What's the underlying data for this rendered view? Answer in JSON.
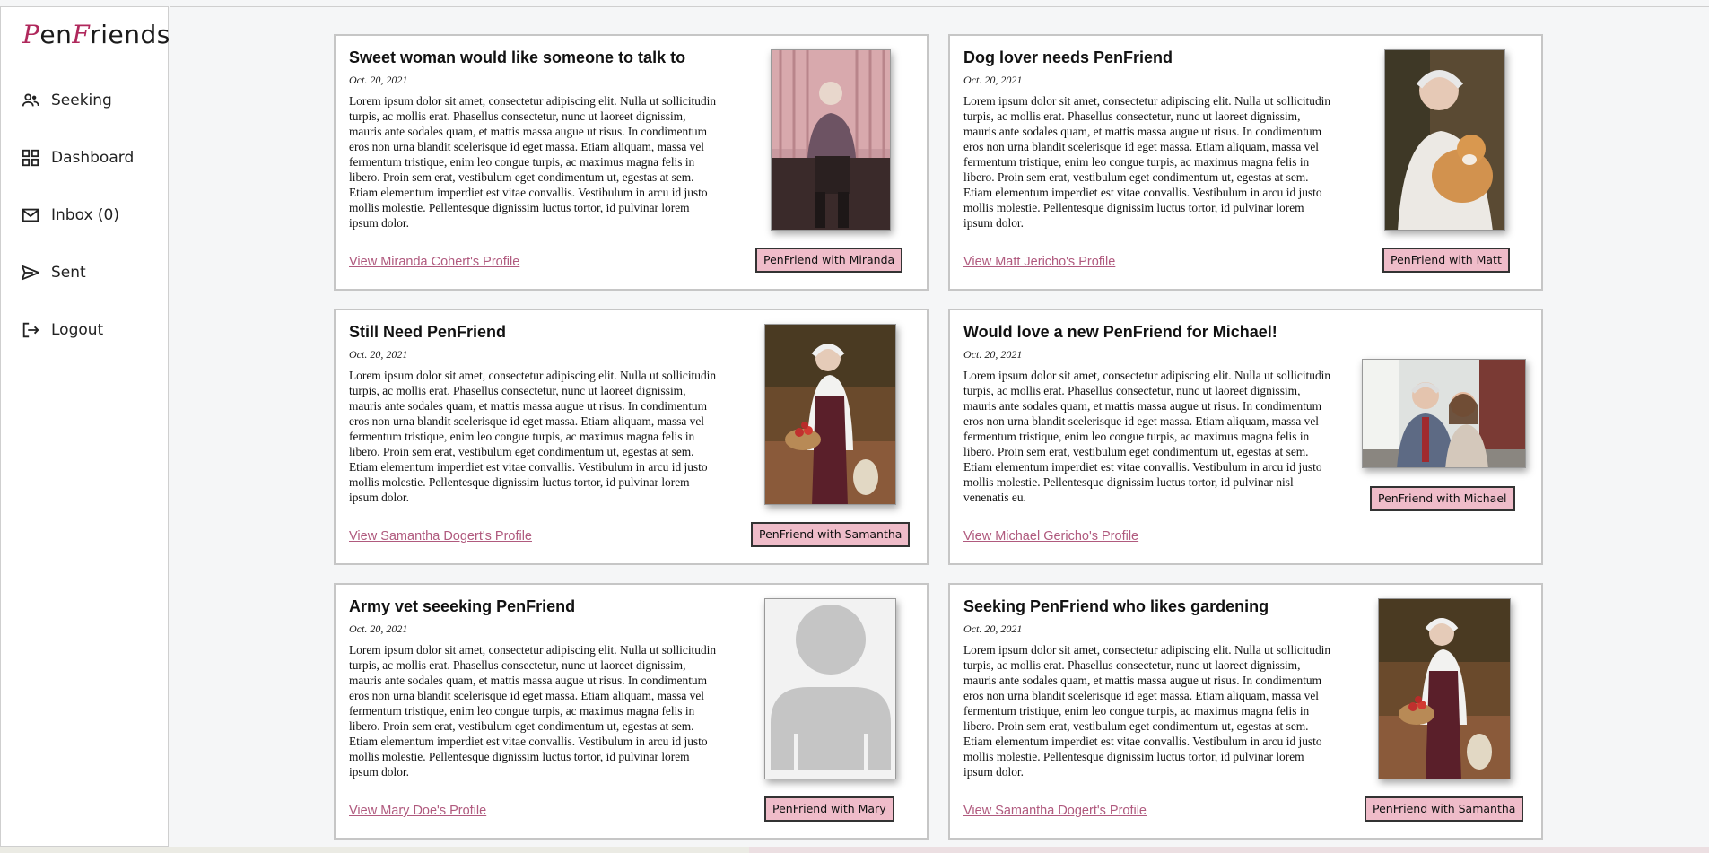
{
  "app": {
    "logo": {
      "part1": "P",
      "part2": "en",
      "part3": "F",
      "part4": "riends"
    },
    "accent_color": "#b0285c",
    "link_color": "#b05a7e",
    "button_color": "#efbcc9"
  },
  "sidebar": {
    "items": [
      {
        "label": "Seeking",
        "icon": "people-icon"
      },
      {
        "label": "Dashboard",
        "icon": "grid-icon"
      },
      {
        "label": "Inbox (0)",
        "icon": "mail-icon"
      },
      {
        "label": "Sent",
        "icon": "send-icon"
      },
      {
        "label": "Logout",
        "icon": "logout-icon"
      }
    ]
  },
  "lorem": "Lorem ipsum dolor sit amet, consectetur adipiscing elit. Nulla ut sollicitudin turpis, ac mollis erat. Phasellus consectetur, nunc ut laoreet dignissim, mauris ante sodales quam, et mattis massa augue ut risus. In condimentum eros non urna blandit scelerisque id eget massa. Etiam aliquam, massa vel fermentum tristique, enim leo congue turpis, ac maximus magna felis in libero. Proin sem erat, vestibulum eget condimentum ut, egestas at sem. Etiam elementum imperdiet est vitae convallis. Vestibulum in arcu id justo mollis molestie. Pellentesque dignissim luctus tortor, id pulvinar lorem ipsum dolor.",
  "cards": [
    {
      "title": "Sweet woman would like someone to talk to",
      "date": "Oct. 20, 2021",
      "body": "Lorem ipsum dolor sit amet, consectetur adipiscing elit. Nulla ut sollicitudin turpis, ac mollis erat. Phasellus consectetur, nunc ut laoreet dignissim, mauris ante sodales quam, et mattis massa augue ut risus. In condimentum eros non urna blandit scelerisque id eget massa. Etiam aliquam, massa vel fermentum tristique, enim leo congue turpis, ac maximus magna felis in libero. Proin sem erat, vestibulum eget condimentum ut, egestas at sem. Etiam elementum imperdiet est vitae convallis. Vestibulum in arcu id justo mollis molestie. Pellentesque dignissim luctus tortor, id pulvinar lorem ipsum dolor.",
      "link": "View Miranda Cohert's Profile",
      "button": "PenFriend with Miranda"
    },
    {
      "title": "Dog lover needs PenFriend",
      "date": "Oct. 20, 2021",
      "body": "Lorem ipsum dolor sit amet, consectetur adipiscing elit. Nulla ut sollicitudin turpis, ac mollis erat. Phasellus consectetur, nunc ut laoreet dignissim, mauris ante sodales quam, et mattis massa augue ut risus. In condimentum eros non urna blandit scelerisque id eget massa. Etiam aliquam, massa vel fermentum tristique, enim leo congue turpis, ac maximus magna felis in libero. Proin sem erat, vestibulum eget condimentum ut, egestas at sem. Etiam elementum imperdiet est vitae convallis. Vestibulum in arcu id justo mollis molestie. Pellentesque dignissim luctus tortor, id pulvinar lorem ipsum dolor.",
      "link": "View Matt Jericho's Profile",
      "button": "PenFriend with Matt"
    },
    {
      "title": "Still Need PenFriend",
      "date": "Oct. 20, 2021",
      "body": "Lorem ipsum dolor sit amet, consectetur adipiscing elit. Nulla ut sollicitudin turpis, ac mollis erat. Phasellus consectetur, nunc ut laoreet dignissim, mauris ante sodales quam, et mattis massa augue ut risus. In condimentum eros non urna blandit scelerisque id eget massa. Etiam aliquam, massa vel fermentum tristique, enim leo congue turpis, ac maximus magna felis in libero. Proin sem erat, vestibulum eget condimentum ut, egestas at sem. Etiam elementum imperdiet est vitae convallis. Vestibulum in arcu id justo mollis molestie. Pellentesque dignissim luctus tortor, id pulvinar lorem ipsum dolor.",
      "link": "View Samantha Dogert's Profile",
      "button": "PenFriend with Samantha"
    },
    {
      "title": "Would love a new PenFriend for Michael!",
      "date": "Oct. 20, 2021",
      "body": "Lorem ipsum dolor sit amet, consectetur adipiscing elit. Nulla ut sollicitudin turpis, ac mollis erat. Phasellus consectetur, nunc ut laoreet dignissim, mauris ante sodales quam, et mattis massa augue ut risus. In condimentum eros non urna blandit scelerisque id eget massa. Etiam aliquam, massa vel fermentum tristique, enim leo congue turpis, ac maximus magna felis in libero. Proin sem erat, vestibulum eget condimentum ut, egestas at sem. Etiam elementum imperdiet est vitae convallis. Vestibulum in arcu id justo mollis molestie. Pellentesque dignissim luctus tortor, id pulvinar nisl venenatis eu.",
      "link": "View Michael Gericho's Profile",
      "button": "PenFriend with Michael"
    },
    {
      "title": "Army vet seeeking PenFriend",
      "date": "Oct. 20, 2021",
      "body": "Lorem ipsum dolor sit amet, consectetur adipiscing elit. Nulla ut sollicitudin turpis, ac mollis erat. Phasellus consectetur, nunc ut laoreet dignissim, mauris ante sodales quam, et mattis massa augue ut risus. In condimentum eros non urna blandit scelerisque id eget massa. Etiam aliquam, massa vel fermentum tristique, enim leo congue turpis, ac maximus magna felis in libero. Proin sem erat, vestibulum eget condimentum ut, egestas at sem. Etiam elementum imperdiet est vitae convallis. Vestibulum in arcu id justo mollis molestie. Pellentesque dignissim luctus tortor, id pulvinar lorem ipsum dolor.",
      "link": "View Mary Doe's Profile",
      "button": "PenFriend with Mary"
    },
    {
      "title": "Seeking PenFriend who likes gardening",
      "date": "Oct. 20, 2021",
      "body": "Lorem ipsum dolor sit amet, consectetur adipiscing elit. Nulla ut sollicitudin turpis, ac mollis erat. Phasellus consectetur, nunc ut laoreet dignissim, mauris ante sodales quam, et mattis massa augue ut risus. In condimentum eros non urna blandit scelerisque id eget massa. Etiam aliquam, massa vel fermentum tristique, enim leo congue turpis, ac maximus magna felis in libero. Proin sem erat, vestibulum eget condimentum ut, egestas at sem. Etiam elementum imperdiet est vitae convallis. Vestibulum in arcu id justo mollis molestie. Pellentesque dignissim luctus tortor, id pulvinar lorem ipsum dolor.",
      "link": "View Samantha Dogert's Profile",
      "button": "PenFriend with Samantha"
    }
  ]
}
